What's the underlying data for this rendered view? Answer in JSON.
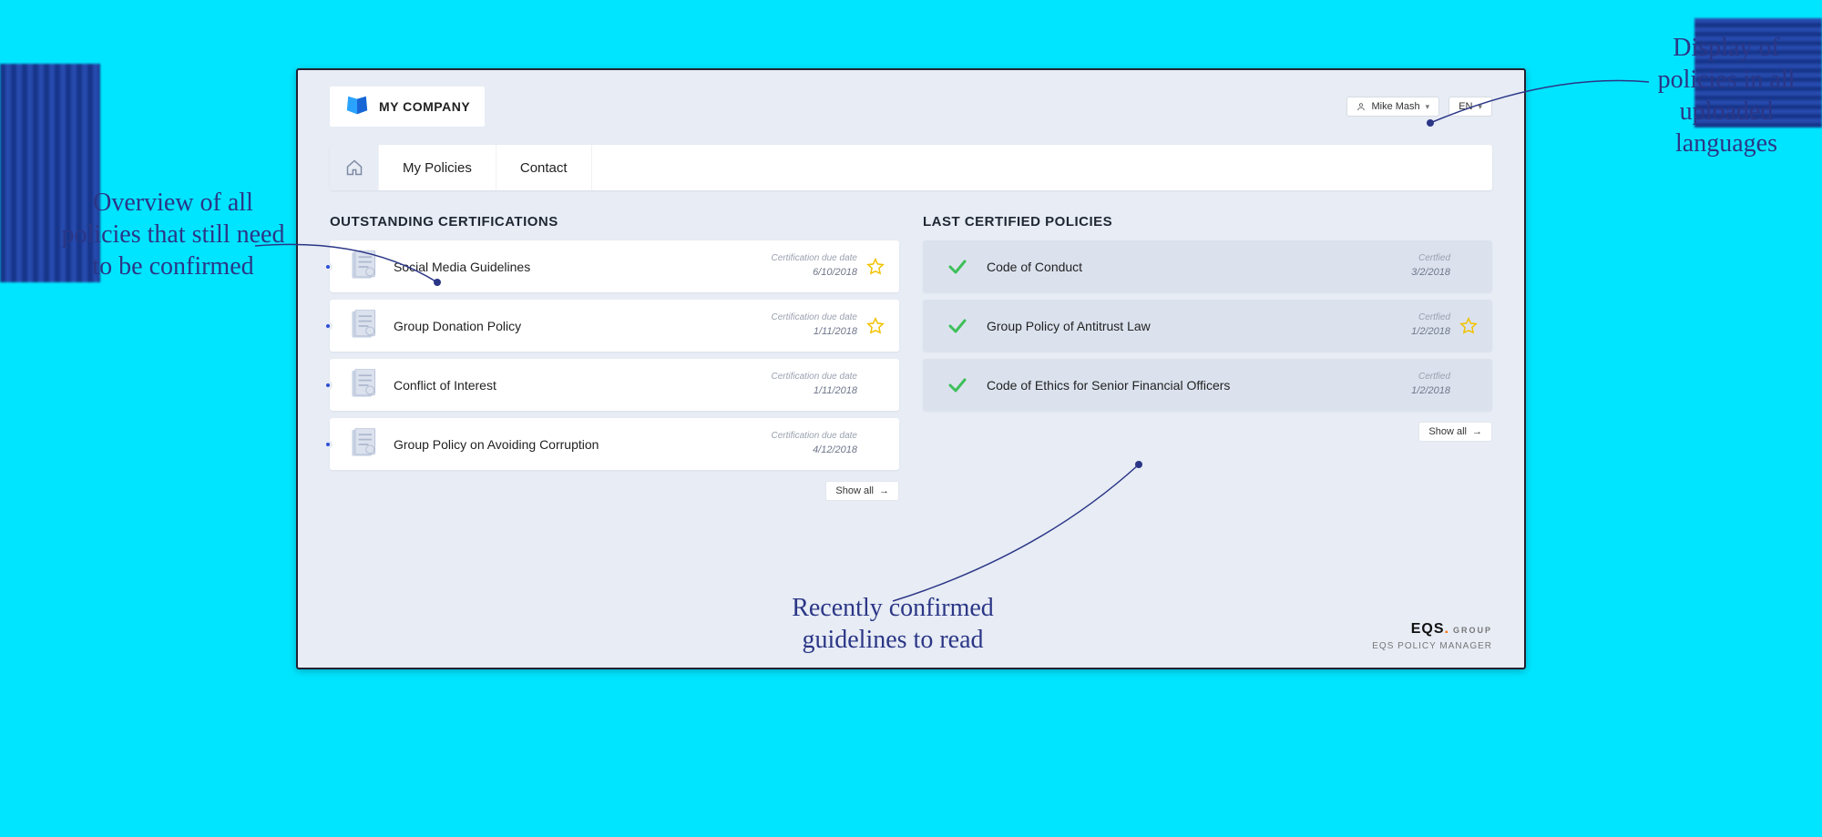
{
  "brand": {
    "name": "MY COMPANY"
  },
  "header": {
    "user": "Mike Mash",
    "lang": "EN"
  },
  "nav": {
    "home_name": "home",
    "items": [
      "My Policies",
      "Contact"
    ]
  },
  "outstanding": {
    "title": "OUTSTANDING CERTIFICATIONS",
    "due_label": "Certification due date",
    "show_all": "Show all",
    "items": [
      {
        "title": "Social Media Guidelines",
        "due": "6/10/2018",
        "starred": true
      },
      {
        "title": "Group Donation Policy",
        "due": "1/11/2018",
        "starred": true
      },
      {
        "title": "Conflict of Interest",
        "due": "1/11/2018",
        "starred": false
      },
      {
        "title": "Group Policy on Avoiding Corruption",
        "due": "4/12/2018",
        "starred": false
      }
    ]
  },
  "certified": {
    "title": "LAST CERTIFIED POLICIES",
    "date_label": "Certfied",
    "show_all": "Show all",
    "items": [
      {
        "title": "Code of Conduct",
        "date": "3/2/2018",
        "starred": false
      },
      {
        "title": "Group Policy of Antitrust Law",
        "date": "1/2/2018",
        "starred": true
      },
      {
        "title": "Code of Ethics for Senior Financial Officers",
        "date": "1/2/2018",
        "starred": false
      }
    ]
  },
  "footer": {
    "brand_main": "EQS",
    "brand_group": "GROUP",
    "product": "EQS POLICY MANAGER"
  },
  "annotations": {
    "left": "Overview of all policies\nthat still need\nto be confirmed",
    "right": "Display of policies\nin all uploaded\nlanguages",
    "bottom": "Recently confirmed\nguidelines to read"
  }
}
